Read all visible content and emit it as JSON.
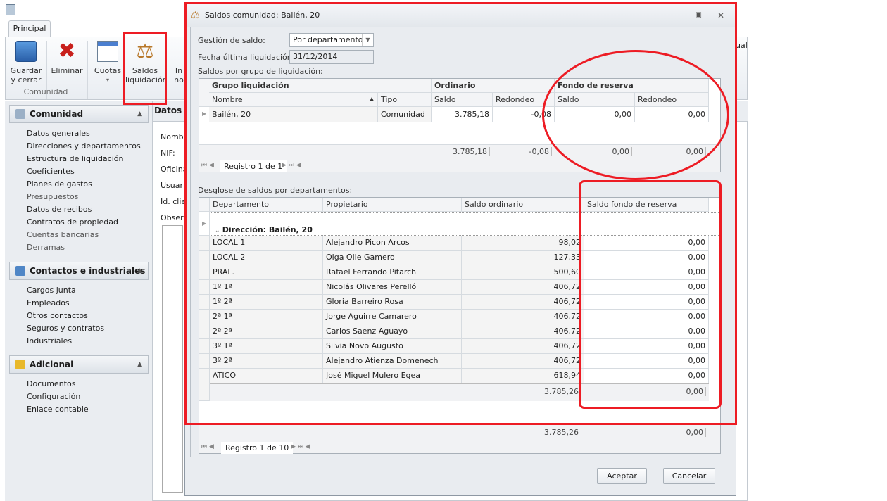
{
  "app": {
    "tab": "Principal",
    "ribbon": {
      "buttons": [
        {
          "label1": "Guardar",
          "label2": "y cerrar"
        },
        {
          "label1": "Eliminar",
          "label2": ""
        },
        {
          "label1": "Cuotas",
          "label2": "▾"
        },
        {
          "label1": "Saldos",
          "label2": "liquidación"
        },
        {
          "label1": "In",
          "label2": "no"
        }
      ],
      "group_label": "Comunidad",
      "right_fragment": "ual"
    }
  },
  "sidebar": {
    "sections": [
      {
        "title": "Comunidad",
        "items": [
          {
            "label": "Datos generales",
            "dim": false
          },
          {
            "label": "Direcciones y departamentos",
            "dim": false
          },
          {
            "label": "Estructura de liquidación",
            "dim": false
          },
          {
            "label": "Coeficientes",
            "dim": false
          },
          {
            "label": "Planes de gastos",
            "dim": false
          },
          {
            "label": "Presupuestos",
            "dim": true
          },
          {
            "label": "Datos de recibos",
            "dim": false
          },
          {
            "label": "Contratos de propiedad",
            "dim": false
          },
          {
            "label": "Cuentas bancarias",
            "dim": true
          },
          {
            "label": "Derramas",
            "dim": true
          }
        ]
      },
      {
        "title": "Contactos e industriales",
        "items": [
          {
            "label": "Cargos junta"
          },
          {
            "label": "Empleados"
          },
          {
            "label": "Otros contactos"
          },
          {
            "label": "Seguros y contratos"
          },
          {
            "label": "Industriales"
          }
        ]
      },
      {
        "title": "Adicional",
        "items": [
          {
            "label": "Documentos"
          },
          {
            "label": "Configuración"
          },
          {
            "label": "Enlace contable"
          }
        ]
      }
    ]
  },
  "main": {
    "title": "Datos g",
    "fields": [
      "Nombre",
      "NIF:",
      "Oficina",
      "Usuario",
      "Id. clie",
      "Observ"
    ]
  },
  "dialog": {
    "title": "Saldos comunidad: Bailén, 20",
    "gestion_label": "Gestión de saldo:",
    "gestion_value": "Por departamento",
    "fecha_label": "Fecha última liquidación:",
    "fecha_value": "31/12/2014",
    "grupo_section": "Saldos por grupo de liquidación:",
    "grupo_grid": {
      "bands": [
        "Grupo liquidación",
        "Ordinario",
        "Fondo de reserva"
      ],
      "columns": [
        "Nombre",
        "Tipo",
        "Saldo",
        "Redondeo",
        "Saldo",
        "Redondeo"
      ],
      "rows": [
        [
          "Bailén, 20",
          "Comunidad",
          "3.785,18",
          "-0,08",
          "0,00",
          "0,00"
        ]
      ],
      "totals": [
        "3.785,18",
        "-0,08",
        "0,00",
        "0,00"
      ],
      "nav": "Registro 1 de 1"
    },
    "desglose_section": "Desglose de saldos por departamentos:",
    "dept_grid": {
      "columns": [
        "Departamento",
        "Propietario",
        "Saldo ordinario",
        "Saldo fondo de reserva"
      ],
      "group": "Dirección: Bailén, 20",
      "rows": [
        [
          "LOCAL 1",
          "Alejandro Picon Arcos",
          "98,02",
          "0,00"
        ],
        [
          "LOCAL 2",
          "Olga Olle Gamero",
          "127,33",
          "0,00"
        ],
        [
          "PRAL.",
          "Rafael Ferrando Pitarch",
          "500,60",
          "0,00"
        ],
        [
          "1º 1ª",
          "Nicolás Olivares Perelló",
          "406,72",
          "0,00"
        ],
        [
          "1º 2ª",
          "Gloria Barreiro Rosa",
          "406,72",
          "0,00"
        ],
        [
          "2ª 1ª",
          "Jorge Aguirre Camarero",
          "406,72",
          "0,00"
        ],
        [
          "2º 2ª",
          "Carlos Saenz Aguayo",
          "406,72",
          "0,00"
        ],
        [
          "3º 1ª",
          "Silvia Novo Augusto",
          "406,72",
          "0,00"
        ],
        [
          "3º 2ª",
          "Alejandro Atienza Domenech",
          "406,72",
          "0,00"
        ],
        [
          "ATICO",
          "José Miguel Mulero Egea",
          "618,94",
          "0,00"
        ]
      ],
      "group_totals": [
        "3.785,26",
        "0,00"
      ],
      "totals": [
        "3.785,26",
        "0,00"
      ],
      "nav": "Registro 1 de 10"
    },
    "ok": "Aceptar",
    "cancel": "Cancelar"
  },
  "colors": {
    "annotation": "#ed1c24"
  }
}
